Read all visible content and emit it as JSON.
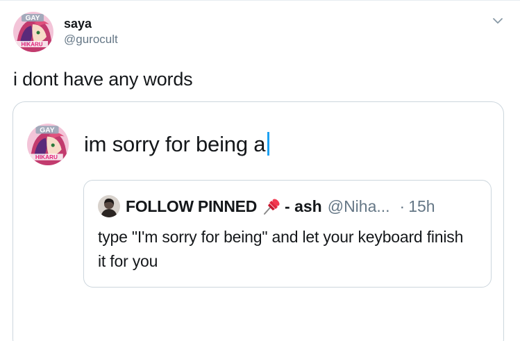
{
  "tweet": {
    "display_name": "saya",
    "handle": "@gurocult",
    "text": "i dont have any words",
    "avatar_badge_top": "GAY",
    "avatar_badge_bottom": "HIKARU"
  },
  "media": {
    "compose_text": "im sorry for being a",
    "avatar_badge_top": "GAY",
    "avatar_badge_bottom": "HIKARU",
    "quoted_tweet": {
      "name": "FOLLOW PINNED",
      "icon": "pushpin-icon",
      "name_suffix": "- ash",
      "handle": "@Niha...",
      "separator": "·",
      "time": "15h",
      "text": "type \"I'm sorry for being\" and let your keyboard finish it for you"
    }
  },
  "colors": {
    "text_primary": "#14171a",
    "text_secondary": "#657786",
    "border": "#ccd6dd",
    "cursor": "#1da1f2"
  }
}
